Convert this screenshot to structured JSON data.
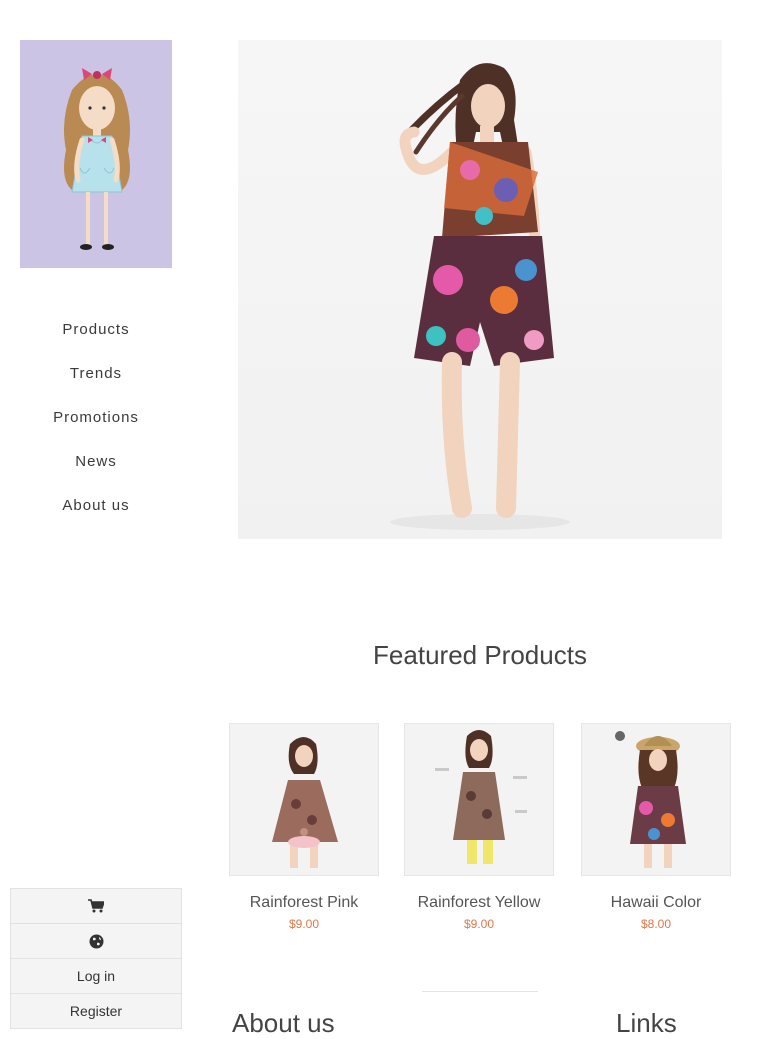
{
  "nav": {
    "items": [
      {
        "label": "Products"
      },
      {
        "label": "Trends"
      },
      {
        "label": "Promotions"
      },
      {
        "label": "News"
      },
      {
        "label": "About us"
      }
    ]
  },
  "featured": {
    "title": "Featured Products",
    "products": [
      {
        "name": "Rainforest Pink",
        "price": "$9.00"
      },
      {
        "name": "Rainforest Yellow",
        "price": "$9.00"
      },
      {
        "name": "Hawaii Color",
        "price": "$8.00"
      }
    ]
  },
  "sections": {
    "about": "About us",
    "links": "Links"
  },
  "account": {
    "login": "Log in",
    "register": "Register",
    "cart_icon": "cart-icon",
    "language_icon": "globe-icon"
  },
  "colors": {
    "logo_bg": "#cbc4e4",
    "price": "#e0784a",
    "panel_bg": "#f4f4f4"
  }
}
